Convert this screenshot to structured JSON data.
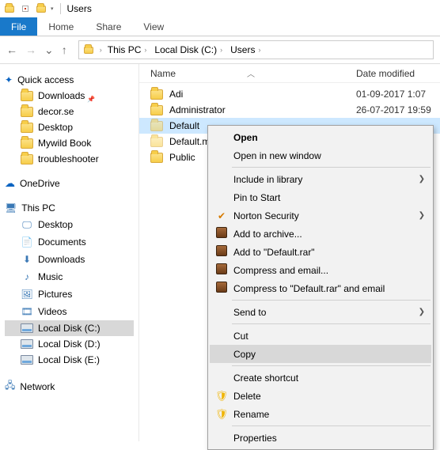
{
  "titlebar": {
    "title": "Users"
  },
  "ribbon": {
    "file": "File",
    "home": "Home",
    "share": "Share",
    "view": "View"
  },
  "address": {
    "parts": [
      "This PC",
      "Local Disk (C:)",
      "Users"
    ]
  },
  "sidebar": {
    "quick_access": "Quick access",
    "qa_items": [
      {
        "label": "Downloads"
      },
      {
        "label": "decor.se"
      },
      {
        "label": "Desktop"
      },
      {
        "label": "Mywild Book"
      },
      {
        "label": "troubleshooter"
      }
    ],
    "onedrive": "OneDrive",
    "thispc": "This PC",
    "pc_items": [
      {
        "label": "Desktop"
      },
      {
        "label": "Documents"
      },
      {
        "label": "Downloads"
      },
      {
        "label": "Music"
      },
      {
        "label": "Pictures"
      },
      {
        "label": "Videos"
      },
      {
        "label": "Local Disk (C:)",
        "selected": true,
        "disk": true
      },
      {
        "label": "Local Disk (D:)",
        "disk": true
      },
      {
        "label": "Local Disk (E:)",
        "disk": true
      }
    ],
    "network": "Network"
  },
  "columns": {
    "name": "Name",
    "date": "Date modified"
  },
  "rows": [
    {
      "name": "Adi",
      "date": "01-09-2017 1:07"
    },
    {
      "name": "Administrator",
      "date": "26-07-2017 19:59"
    },
    {
      "name": "Default",
      "date": "",
      "selected": true,
      "hidden": true
    },
    {
      "name": "Default.mi",
      "date": "",
      "hidden": true
    },
    {
      "name": "Public",
      "date": ""
    }
  ],
  "ctx": {
    "open": "Open",
    "open_new": "Open in new window",
    "include": "Include in library",
    "pin": "Pin to Start",
    "norton": "Norton Security",
    "add_archive": "Add to archive...",
    "add_default": "Add to \"Default.rar\"",
    "compress_email": "Compress and email...",
    "compress_default": "Compress to \"Default.rar\" and email",
    "send_to": "Send to",
    "cut": "Cut",
    "copy": "Copy",
    "shortcut": "Create shortcut",
    "delete": "Delete",
    "rename": "Rename",
    "properties": "Properties"
  }
}
